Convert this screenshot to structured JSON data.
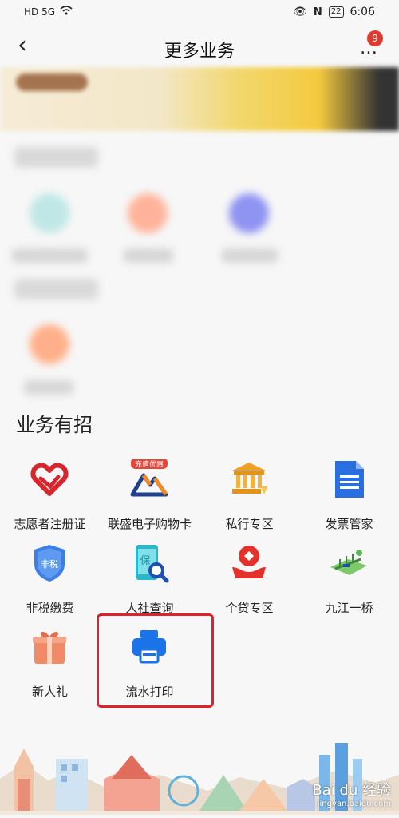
{
  "status_bar": {
    "left_icons": "HD 5G",
    "time": "6:06",
    "battery": "22"
  },
  "nav": {
    "back": "‹",
    "title": "更多业务",
    "more": "…",
    "badge": "9"
  },
  "section": {
    "title": "业务有招"
  },
  "grid": [
    {
      "label": "志愿者注册证",
      "icon": "heart-hand-icon"
    },
    {
      "label": "联盛电子购物卡",
      "icon": "mountain-card-icon",
      "tag": "充值优惠"
    },
    {
      "label": "私行专区",
      "icon": "bank-icon"
    },
    {
      "label": "发票管家",
      "icon": "document-icon"
    },
    {
      "label": "非税缴费",
      "icon": "shield-icon",
      "icon_text": "非税"
    },
    {
      "label": "人社查询",
      "icon": "phone-search-icon"
    },
    {
      "label": "个贷专区",
      "icon": "hand-coin-icon"
    },
    {
      "label": "九江一桥",
      "icon": "bridge-icon"
    },
    {
      "label": "新人礼",
      "icon": "gift-icon"
    },
    {
      "label": "流水打印",
      "icon": "printer-icon"
    }
  ],
  "watermark": {
    "text": "Bai du 经验",
    "sub": "jingyan.baidu.com"
  },
  "colors": {
    "accent_red": "#e0202a",
    "blue": "#1a73e8",
    "badge": "#e23a2e"
  }
}
